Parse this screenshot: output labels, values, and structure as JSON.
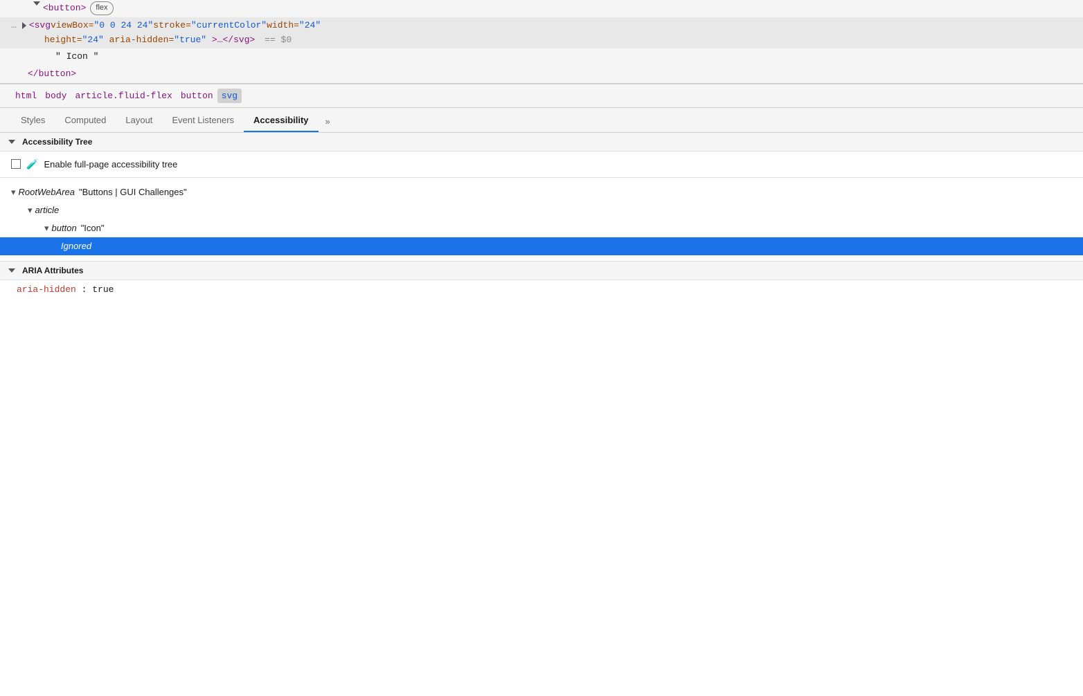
{
  "html_tree": {
    "lines": [
      {
        "id": "button-open",
        "indent": 0,
        "content": "<button>",
        "type": "tag-open-with-badge",
        "badge": "flex",
        "has_triangle_down": true
      },
      {
        "id": "svg-line",
        "indent": 1,
        "content": "<svg viewBox=\"0 0 24 24\" stroke=\"currentColor\" width=\"24\"",
        "type": "highlighted-tag",
        "has_triangle_right": true,
        "has_dots": true,
        "suffix": " == $0",
        "continuation": "height=\"24\" aria-hidden=\"true\">…</svg>"
      },
      {
        "id": "icon-text",
        "indent": 2,
        "content": "\" Icon \"",
        "type": "text-node"
      },
      {
        "id": "button-close",
        "indent": 1,
        "content": "</button>",
        "type": "tag-close"
      }
    ]
  },
  "breadcrumb": {
    "items": [
      {
        "label": "html",
        "active": false
      },
      {
        "label": "body",
        "active": false
      },
      {
        "label": "article.fluid-flex",
        "active": false
      },
      {
        "label": "button",
        "active": false
      },
      {
        "label": "svg",
        "active": true
      }
    ]
  },
  "tabs": {
    "items": [
      {
        "label": "Styles",
        "active": false
      },
      {
        "label": "Computed",
        "active": false
      },
      {
        "label": "Layout",
        "active": false
      },
      {
        "label": "Event Listeners",
        "active": false
      },
      {
        "label": "Accessibility",
        "active": true
      },
      {
        "label": "»",
        "active": false
      }
    ]
  },
  "accessibility_section": {
    "title": "Accessibility Tree",
    "enable_label": "Enable full-page accessibility tree",
    "tree_nodes": [
      {
        "id": "root-web-area",
        "indent": 0,
        "type": "RootWebArea",
        "name": "\"Buttons | GUI Challenges\"",
        "chevron": "down",
        "selected": false
      },
      {
        "id": "article-node",
        "indent": 1,
        "type": "article",
        "name": "",
        "chevron": "down",
        "selected": false
      },
      {
        "id": "button-node",
        "indent": 2,
        "type": "button",
        "name": "\"Icon\"",
        "chevron": "down",
        "selected": false
      },
      {
        "id": "ignored-node",
        "indent": 3,
        "type": "Ignored",
        "name": "",
        "chevron": "none",
        "selected": true
      }
    ]
  },
  "aria_section": {
    "title": "ARIA Attributes",
    "attributes": [
      {
        "name": "aria-hidden",
        "value": "true"
      }
    ]
  }
}
